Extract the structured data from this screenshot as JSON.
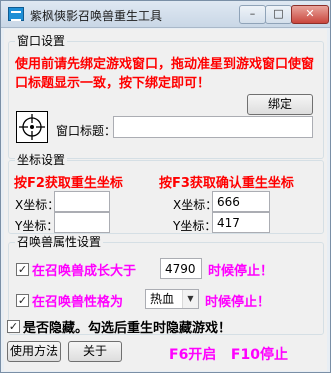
{
  "window": {
    "title": "紫枫傸影召唤兽重生工具",
    "minimize": "–",
    "maximize": "□",
    "close": "✕"
  },
  "window_setup": {
    "legend": "窗口设置",
    "instruction": "使用前请先绑定游戏窗口，拖动准星到游戏窗口使窗口标题显示一致，按下绑定即可！",
    "bind_button": "绑定",
    "window_title_label": "窗口标题：",
    "window_title_value": ""
  },
  "coords": {
    "legend": "坐标设置",
    "f2_hint": "按F2获取重生坐标",
    "f3_hint": "按F3获取确认重生坐标",
    "x_label": "X坐标：",
    "y_label": "Y坐标：",
    "rebirth_x": "",
    "rebirth_y": "",
    "confirm_x": "666",
    "confirm_y": "417"
  },
  "pet": {
    "legend": "召唤兽属性设置",
    "growth_prefix": "在召唤兽成长大于",
    "growth_value": "4790",
    "growth_suffix": "时候停止！",
    "nature_prefix": "在召唤兽性格为",
    "nature_value": "热血",
    "nature_suffix": "时候停止！",
    "growth_checked": "✓",
    "nature_checked": "✓"
  },
  "hide": {
    "checked": "✓",
    "label": "是否隐藏。勾选后重生时隐藏游戏！"
  },
  "footer": {
    "usage_button": "使用方法",
    "about_button": "关于",
    "hotkeys": "F6开启   F10停止"
  }
}
